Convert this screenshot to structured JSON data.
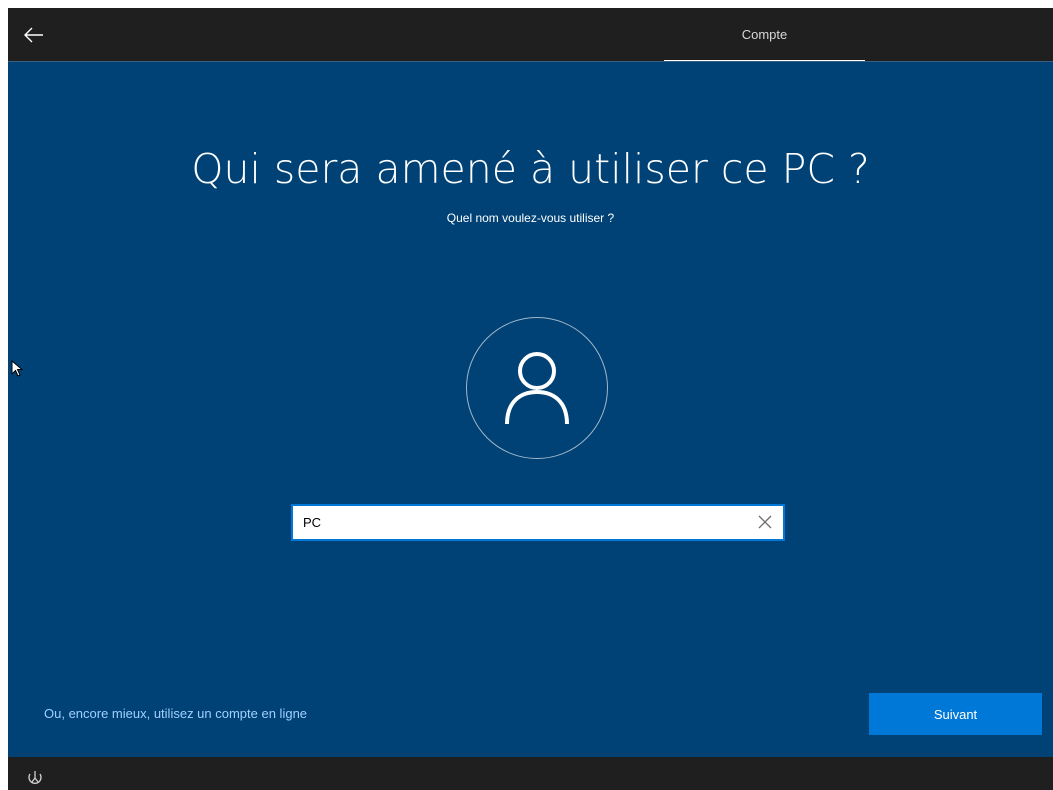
{
  "header": {
    "back_icon": "arrow-left-icon",
    "step_label": "Compte"
  },
  "main": {
    "title": "Qui sera amené à utiliser ce PC ?",
    "subtitle": "Quel nom voulez-vous utiliser ?",
    "avatar_icon": "user-icon",
    "name_input": {
      "value": "PC",
      "placeholder": ""
    },
    "clear_icon": "close-icon",
    "online_account_link": "Ou, encore mieux, utilisez un compte en ligne",
    "next_button": "Suivant"
  },
  "footer": {
    "accessibility_icon": "accessibility-icon"
  },
  "colors": {
    "background": "#004275",
    "bar": "#1f1f1f",
    "accent": "#0078d7",
    "link": "#9fd0ff"
  }
}
